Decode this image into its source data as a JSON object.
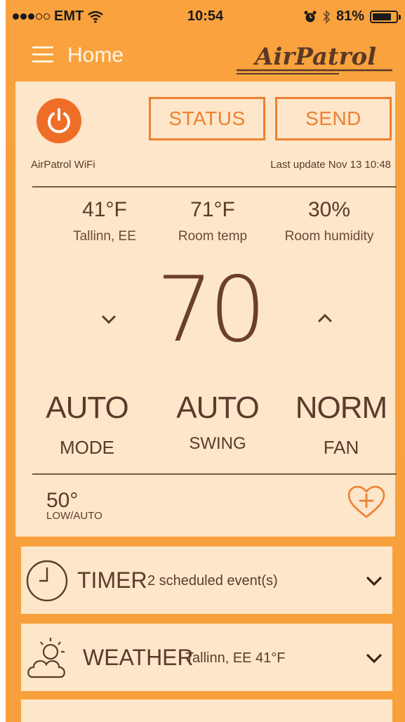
{
  "status_bar": {
    "carrier": "EMT",
    "time": "10:54",
    "battery_percent_text": "81%",
    "battery_level": 0.81,
    "signal_bars_filled": 3,
    "signal_bars_total": 5
  },
  "nav": {
    "title": "Home",
    "logo_text": "AirPatrol"
  },
  "device": {
    "name": "AirPatrol WiFi",
    "last_update": "Last update Nov 13 10:48",
    "status_button": "STATUS",
    "send_button": "SEND"
  },
  "readings": [
    {
      "value": "41°F",
      "label": "Tallinn, EE"
    },
    {
      "value": "71°F",
      "label": "Room temp"
    },
    {
      "value": "30%",
      "label": "Room humidity"
    }
  ],
  "setpoint": {
    "value": "70"
  },
  "modes": [
    {
      "value": "AUTO",
      "label": "MODE"
    },
    {
      "value": "AUTO",
      "label": "SWING"
    },
    {
      "value": "NORM",
      "label": "FAN"
    }
  ],
  "low_auto": {
    "value": "50°",
    "label": "LOW/AUTO"
  },
  "timer": {
    "title": "TIMER",
    "subtitle": "2 scheduled event(s)"
  },
  "weather": {
    "title": "WEATHER",
    "subtitle": "Tallinn, EE 41°F"
  },
  "colors": {
    "background": "#f9a23e",
    "card": "#fde6c9",
    "accent": "#ee8030",
    "power": "#ee6e28",
    "text": "#5b3b2c"
  }
}
